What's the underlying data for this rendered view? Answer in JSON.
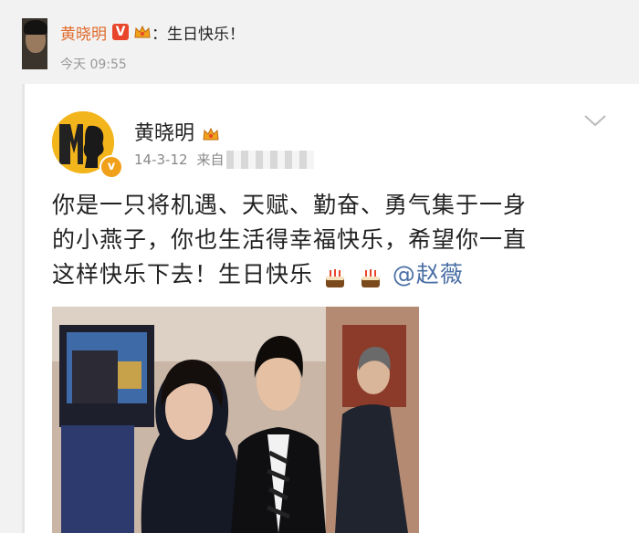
{
  "notification": {
    "username": "黄晓明",
    "verified_badge": "V",
    "message": "：生日快乐！",
    "time": "今天 09:55"
  },
  "post": {
    "author": "黄晓明",
    "date": "14-3-12",
    "source_prefix": "来自",
    "text_line1": "你是一只将机遇、天赋、勤奋、勇气集于一身",
    "text_line2": "的小燕子，你也生活得幸福快乐，希望你一直",
    "text_line3": "这样快乐下去！生日快乐",
    "mention": "@赵薇"
  },
  "colors": {
    "name_orange": "#e06a2b",
    "mention_blue": "#4a6fa5",
    "verified_red": "#e8452b",
    "avatar_yellow": "#f3b51c"
  },
  "icons": [
    "crown-icon",
    "chevron-down-icon",
    "birthday-cake-icon",
    "verified-badge-icon"
  ]
}
